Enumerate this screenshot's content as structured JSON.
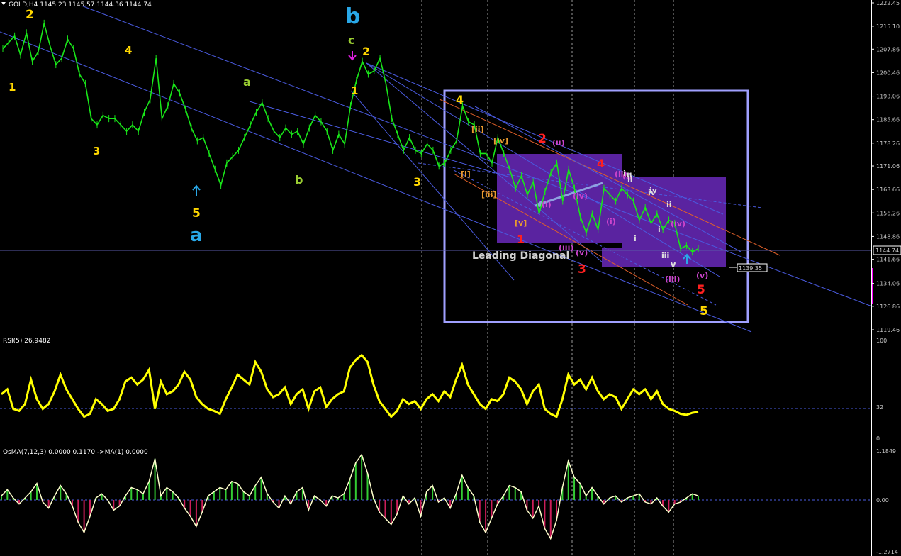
{
  "header": {
    "main": "GOLD,H4  1145.23 1145.57 1144.36 1144.74",
    "rsi": "RSI(5) 26.9482",
    "osma": "OsMA(7,12,3) 0.0000 0.1170  ->MA(1) 0.0000"
  },
  "colors": {
    "background": "#000000",
    "bull_candle": "#19e619",
    "grid": "#9a9a9a",
    "trend_line": "#4a5be0",
    "channel_line": "#e0602a",
    "rsi_line": "#ffff00",
    "osma_line": "#ffffcc",
    "osma_pos": "#33cc33",
    "osma_neg": "#cc1e5a",
    "box": "#a0a0ff",
    "purple_box": "#5a23a0"
  },
  "chart_data": [
    {
      "type": "line",
      "panel": "price",
      "symbol": "GOLD",
      "timeframe": "H4",
      "ohlc_last": {
        "open": 1145.23,
        "high": 1145.57,
        "low": 1144.36,
        "close": 1144.74
      },
      "ylim": [
        1119.46,
        1222.45
      ],
      "yticks": [
        1222.45,
        1215.1,
        1207.86,
        1200.46,
        1193.06,
        1185.66,
        1178.26,
        1171.06,
        1163.66,
        1156.26,
        1148.86,
        1141.66,
        1134.06,
        1126.86,
        1119.46
      ],
      "current_price": "1144.74",
      "target_price": "1139.35",
      "series": [
        {
          "values": [
            1208,
            1210,
            1212,
            1206,
            1213,
            1204,
            1207,
            1216,
            1209,
            1203,
            1205,
            1211,
            1208,
            1200,
            1197,
            1186,
            1184,
            1187,
            1186,
            1186,
            1184,
            1182,
            1184,
            1182,
            1188,
            1192,
            1205,
            1186,
            1190,
            1197,
            1194,
            1189,
            1183,
            1179,
            1180,
            1175,
            1170,
            1165,
            1172,
            1174,
            1176,
            1180,
            1184,
            1188,
            1191,
            1186,
            1182,
            1180,
            1183,
            1181,
            1182,
            1178,
            1183,
            1187,
            1185,
            1182,
            1176,
            1181,
            1178,
            1190,
            1198,
            1204,
            1200,
            1201,
            1205,
            1197,
            1186,
            1181,
            1176,
            1180,
            1176,
            1175,
            1178,
            1176,
            1171,
            1172,
            1176,
            1179,
            1190,
            1185,
            1184,
            1175,
            1175,
            1172,
            1180,
            1175,
            1170,
            1164,
            1168,
            1162,
            1166,
            1156,
            1163,
            1169,
            1172,
            1160,
            1170,
            1164,
            1155,
            1150,
            1156,
            1151,
            1164,
            1162,
            1160,
            1164,
            1162,
            1160,
            1154,
            1158,
            1153,
            1156,
            1151,
            1154,
            1153,
            1145,
            1146,
            1144,
            1145
          ]
        }
      ],
      "annotations": [
        {
          "text": "2",
          "color": "#ffd700"
        },
        {
          "text": "1",
          "color": "#ffd700"
        },
        {
          "text": "3",
          "color": "#ffd700"
        },
        {
          "text": "4",
          "color": "#ffd700"
        },
        {
          "text": "5",
          "color": "#ffd700"
        },
        {
          "text": "a",
          "color": "#29a8e8"
        },
        {
          "text": "a",
          "color": "#9acd32"
        },
        {
          "text": "b",
          "color": "#9acd32"
        },
        {
          "text": "b",
          "color": "#29a8e8"
        },
        {
          "text": "c",
          "color": "#9acd32"
        },
        {
          "text": "2",
          "color": "#ffd700"
        },
        {
          "text": "1",
          "color": "#ffd700"
        },
        {
          "text": "3",
          "color": "#ffd700"
        },
        {
          "text": "4",
          "color": "#ffd700"
        },
        {
          "text": "5",
          "color": "#ffd700"
        },
        {
          "text": "1",
          "color": "#ff2020"
        },
        {
          "text": "2",
          "color": "#ff2020"
        },
        {
          "text": "3",
          "color": "#ff2020"
        },
        {
          "text": "4",
          "color": "#ff2020"
        },
        {
          "text": "5",
          "color": "#ff2020"
        },
        {
          "text": "[i]",
          "color": "#e89a30"
        },
        {
          "text": "[ii]",
          "color": "#e89a30"
        },
        {
          "text": "[iii]",
          "color": "#e89a30"
        },
        {
          "text": "[iv]",
          "color": "#e89a30"
        },
        {
          "text": "[v]",
          "color": "#e89a30"
        },
        {
          "text": "(i)",
          "color": "#cc44cc"
        },
        {
          "text": "(ii)",
          "color": "#cc44cc"
        },
        {
          "text": "(iii)",
          "color": "#cc44cc"
        },
        {
          "text": "(iv)",
          "color": "#cc44cc"
        },
        {
          "text": "(v)",
          "color": "#cc44cc"
        },
        {
          "text": "(i)",
          "color": "#cc44cc"
        },
        {
          "text": "(ii)",
          "color": "#cc44cc"
        },
        {
          "text": "(i)",
          "color": "#cc44cc"
        },
        {
          "text": "(iii)",
          "color": "#cc44cc"
        },
        {
          "text": "(iv)",
          "color": "#cc44cc"
        },
        {
          "text": "(v)",
          "color": "#cc44cc"
        },
        {
          "text": "i",
          "color": "#dddddd"
        },
        {
          "text": "ii",
          "color": "#dddddd"
        },
        {
          "text": "iii",
          "color": "#dddddd"
        },
        {
          "text": "iv",
          "color": "#dddddd"
        },
        {
          "text": "v",
          "color": "#dddddd"
        },
        {
          "text": "i",
          "color": "#dddddd"
        },
        {
          "text": "ii",
          "color": "#dddddd"
        },
        {
          "text": "iii",
          "color": "#dddddd"
        },
        {
          "text": "iv",
          "color": "#dddddd"
        },
        {
          "text": "v",
          "color": "#dddddd"
        },
        {
          "text": "i",
          "color": "#dddddd"
        },
        {
          "text": "ii",
          "color": "#dddddd"
        },
        {
          "text": "Leading Diagonal",
          "color": "#d0d0d0"
        }
      ]
    },
    {
      "type": "line",
      "panel": "rsi",
      "title": "RSI(5) 26.9482",
      "ylim": [
        0,
        100
      ],
      "yticks": [
        100,
        32,
        0
      ],
      "series": [
        {
          "values": [
            45,
            50,
            30,
            28,
            35,
            60,
            40,
            30,
            35,
            48,
            65,
            50,
            40,
            30,
            22,
            25,
            40,
            35,
            28,
            30,
            40,
            58,
            62,
            55,
            60,
            70,
            30,
            58,
            45,
            48,
            55,
            68,
            60,
            42,
            35,
            30,
            28,
            25,
            40,
            52,
            65,
            60,
            55,
            78,
            68,
            50,
            42,
            45,
            52,
            35,
            45,
            50,
            30,
            48,
            52,
            32,
            40,
            45,
            48,
            72,
            80,
            85,
            78,
            55,
            38,
            30,
            22,
            28,
            40,
            35,
            38,
            30,
            40,
            45,
            38,
            48,
            42,
            60,
            75,
            55,
            45,
            35,
            30,
            40,
            38,
            45,
            62,
            58,
            50,
            35,
            48,
            55,
            30,
            25,
            22,
            40,
            65,
            55,
            60,
            50,
            62,
            48,
            40,
            45,
            42,
            30,
            40,
            50,
            45,
            50,
            40,
            48,
            35,
            30,
            28,
            25,
            24,
            26,
            27
          ]
        }
      ]
    },
    {
      "type": "bar",
      "panel": "osma",
      "title": "OsMA(7,12,3) 0.0000 0.1170  ->MA(1) 0.0000",
      "ylim": [
        -1.2714,
        1.1849
      ],
      "yticks": [
        1.1849,
        0.0,
        -1.2714
      ],
      "values": [
        0.1,
        0.25,
        0.05,
        -0.1,
        0.05,
        0.2,
        0.4,
        -0.05,
        -0.2,
        0.1,
        0.35,
        0.15,
        -0.15,
        -0.55,
        -0.8,
        -0.4,
        0.05,
        0.15,
        0.0,
        -0.25,
        -0.15,
        0.1,
        0.3,
        0.25,
        0.15,
        0.45,
        1.0,
        0.1,
        0.3,
        0.2,
        0.05,
        -0.2,
        -0.4,
        -0.65,
        -0.3,
        0.1,
        0.2,
        0.3,
        0.25,
        0.45,
        0.4,
        0.2,
        0.1,
        0.35,
        0.55,
        0.15,
        -0.05,
        -0.2,
        0.1,
        -0.1,
        0.2,
        0.3,
        -0.25,
        0.1,
        0.0,
        -0.15,
        0.1,
        0.05,
        0.15,
        0.5,
        0.9,
        1.1,
        0.65,
        0.05,
        -0.3,
        -0.45,
        -0.6,
        -0.35,
        0.1,
        -0.1,
        0.05,
        -0.4,
        0.2,
        0.35,
        -0.05,
        0.05,
        -0.2,
        0.15,
        0.6,
        0.3,
        0.1,
        -0.55,
        -0.8,
        -0.45,
        -0.1,
        0.1,
        0.35,
        0.3,
        0.2,
        -0.25,
        -0.45,
        -0.15,
        -0.7,
        -0.95,
        -0.5,
        0.3,
        0.95,
        0.55,
        0.4,
        0.1,
        0.3,
        0.1,
        -0.1,
        0.05,
        0.1,
        -0.05,
        0.05,
        0.1,
        0.15,
        -0.05,
        -0.1,
        0.05,
        -0.15,
        -0.3,
        -0.1,
        -0.05,
        0.05,
        0.15,
        0.1
      ]
    }
  ]
}
